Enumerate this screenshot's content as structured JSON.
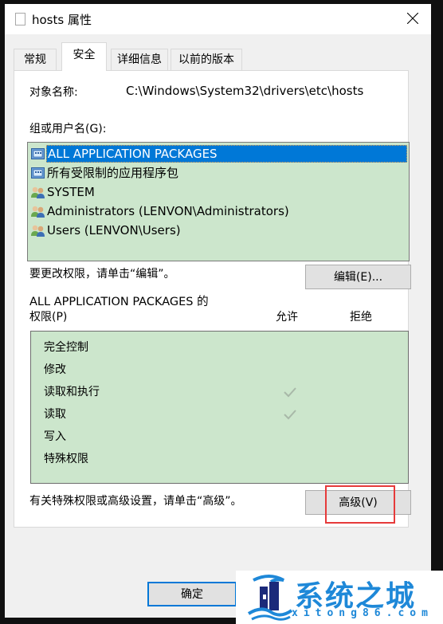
{
  "window": {
    "title": "hosts 属性",
    "close_label": "×"
  },
  "tabs": [
    {
      "label": "常规",
      "active": false
    },
    {
      "label": "安全",
      "active": true
    },
    {
      "label": "详细信息",
      "active": false
    },
    {
      "label": "以前的版本",
      "active": false
    }
  ],
  "security": {
    "object_name_label": "对象名称:",
    "object_name_value": "C:\\Windows\\System32\\drivers\\etc\\hosts",
    "groups_label": "组或用户名(G):",
    "groups": [
      {
        "name": "ALL APPLICATION PACKAGES",
        "icon": "app-package-icon",
        "selected": true
      },
      {
        "name": "所有受限制的应用程序包",
        "icon": "app-package-icon",
        "selected": false
      },
      {
        "name": "SYSTEM",
        "icon": "user-group-icon",
        "selected": false
      },
      {
        "name": "Administrators (LENVON\\Administrators)",
        "icon": "user-group-icon",
        "selected": false
      },
      {
        "name": "Users (LENVON\\Users)",
        "icon": "user-group-icon",
        "selected": false
      }
    ],
    "edit_hint": "要更改权限，请单击“编辑”。",
    "edit_button": "编辑(E)...",
    "permissions_for_line1": "ALL APPLICATION PACKAGES 的",
    "permissions_for_line2": "权限(P)",
    "allow_header": "允许",
    "deny_header": "拒绝",
    "permissions": [
      {
        "name": "完全控制",
        "allow": false,
        "deny": false
      },
      {
        "name": "修改",
        "allow": false,
        "deny": false
      },
      {
        "name": "读取和执行",
        "allow": true,
        "deny": false
      },
      {
        "name": "读取",
        "allow": true,
        "deny": false
      },
      {
        "name": "写入",
        "allow": false,
        "deny": false
      },
      {
        "name": "特殊权限",
        "allow": false,
        "deny": false
      }
    ],
    "advanced_hint": "有关特殊权限或高级设置，请单击“高级”。",
    "advanced_button": "高级(V)"
  },
  "footer": {
    "ok_button": "确定"
  },
  "watermark": {
    "brand": "系统之城",
    "url": "xitong86.com"
  },
  "colors": {
    "selection": "#0078d7",
    "list_bg": "#cce6cc",
    "highlight_box": "#e63a3a",
    "brand": "#1e88d8"
  }
}
